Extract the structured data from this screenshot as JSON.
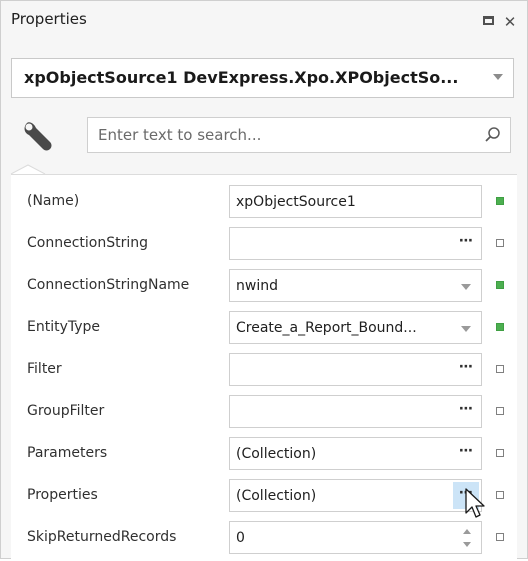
{
  "panel": {
    "title": "Properties"
  },
  "selector": {
    "value": "xpObjectSource1   DevExpress.Xpo.XPObjectSo..."
  },
  "search": {
    "placeholder": "Enter text to search..."
  },
  "properties": [
    {
      "name": "(Name)",
      "value": "xpObjectSource1",
      "editor": "text",
      "modified": true
    },
    {
      "name": "ConnectionString",
      "value": "",
      "editor": "ellipsis",
      "modified": false
    },
    {
      "name": "ConnectionStringName",
      "value": "nwind",
      "editor": "dropdown",
      "modified": true
    },
    {
      "name": "EntityType",
      "value": "Create_a_Report_Bound...",
      "editor": "dropdown",
      "modified": true
    },
    {
      "name": "Filter",
      "value": "",
      "editor": "ellipsis",
      "modified": false
    },
    {
      "name": "GroupFilter",
      "value": "",
      "editor": "ellipsis",
      "modified": false
    },
    {
      "name": "Parameters",
      "value": "(Collection)",
      "editor": "ellipsis",
      "modified": false
    },
    {
      "name": "Properties",
      "value": "(Collection)",
      "editor": "ellipsis-active",
      "modified": false
    },
    {
      "name": "SkipReturnedRecords",
      "value": "0",
      "editor": "spin",
      "modified": false
    }
  ],
  "icons": {
    "wrench": "wrench-icon",
    "search": "search-icon",
    "restore": "restore-window-icon",
    "close": "close-icon",
    "ellipsis": "⋯",
    "cursor": "mouse-pointer-icon"
  },
  "colors": {
    "modified_marker": "#4caf50",
    "active_button": "#cce4f7",
    "panel_bg": "#f6f6f6"
  }
}
